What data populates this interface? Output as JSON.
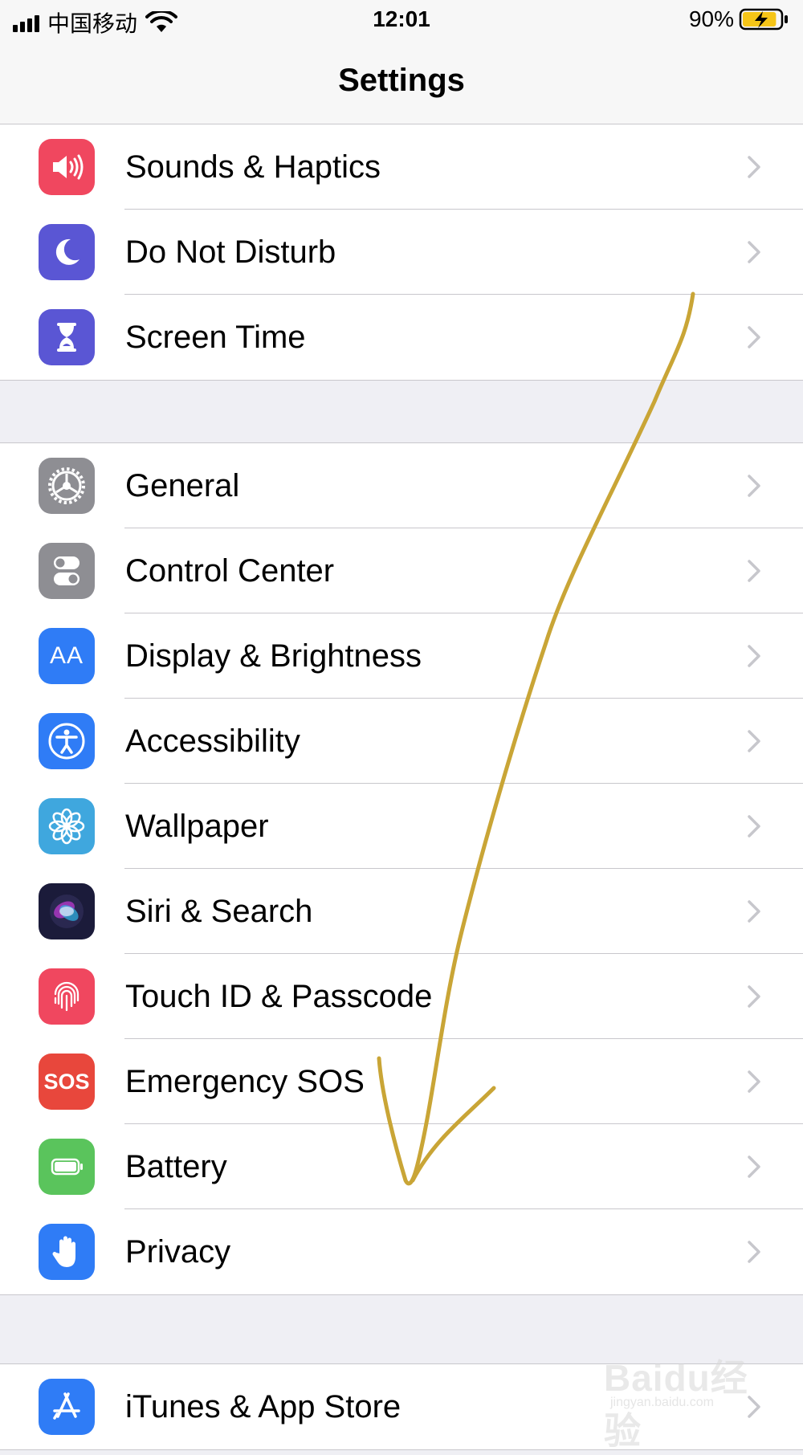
{
  "status_bar": {
    "carrier": "中国移动",
    "time": "12:01",
    "battery_percent": "90%",
    "signal_bars": 4,
    "battery_level": 0.9,
    "charging": true
  },
  "nav": {
    "title": "Settings"
  },
  "groups": [
    {
      "rows": [
        {
          "label": "Sounds & Haptics",
          "icon": "speaker-icon",
          "color": "#f0475f"
        },
        {
          "label": "Do Not Disturb",
          "icon": "moon-icon",
          "color": "#5a56d4"
        },
        {
          "label": "Screen Time",
          "icon": "hourglass-icon",
          "color": "#5a56d4"
        }
      ]
    },
    {
      "rows": [
        {
          "label": "General",
          "icon": "gear-icon",
          "color": "#8e8e93"
        },
        {
          "label": "Control Center",
          "icon": "toggles-icon",
          "color": "#8e8e93"
        },
        {
          "label": "Display & Brightness",
          "icon": "text-size-icon",
          "color": "#2f7cf6",
          "icon_text": "AA"
        },
        {
          "label": "Accessibility",
          "icon": "accessibility-icon",
          "color": "#2f7cf6"
        },
        {
          "label": "Wallpaper",
          "icon": "flower-icon",
          "color": "#3fa7de"
        },
        {
          "label": "Siri & Search",
          "icon": "siri-icon",
          "color": "#1b1b3a"
        },
        {
          "label": "Touch ID & Passcode",
          "icon": "fingerprint-icon",
          "color": "#f0475f"
        },
        {
          "label": "Emergency SOS",
          "icon": "sos-icon",
          "color": "#e8473c",
          "icon_text": "SOS"
        },
        {
          "label": "Battery",
          "icon": "battery-icon",
          "color": "#5ac45c"
        },
        {
          "label": "Privacy",
          "icon": "hand-icon",
          "color": "#2f7cf6"
        }
      ]
    },
    {
      "rows": [
        {
          "label": "iTunes & App Store",
          "icon": "app-store-icon",
          "color": "#2f7cf6"
        }
      ]
    }
  ],
  "colors": {
    "annotation_stroke": "#c9a536",
    "separator": "#c8c7cc",
    "chevron": "#c7c7cc",
    "background": "#efeff4"
  },
  "watermark": {
    "text": "Baidu经验",
    "subtext": "jingyan.baidu.com"
  }
}
